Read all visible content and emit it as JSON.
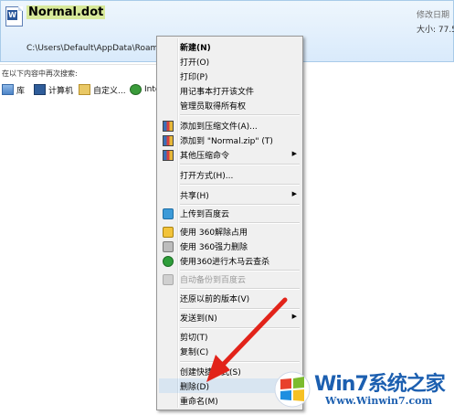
{
  "result": {
    "file_name": "Normal.dot",
    "file_path": "C:\\Users\\Default\\AppData\\Roamin",
    "modified_label": "修改日期",
    "size_label": "大小:",
    "size_value": "77.5"
  },
  "search_again": {
    "label": "在以下内容中再次搜索:",
    "locations": [
      {
        "label": "库",
        "icon": "library-icon"
      },
      {
        "label": "计算机",
        "icon": "computer-icon"
      },
      {
        "label": "自定义...",
        "icon": "folder-icon"
      },
      {
        "label": "Inte",
        "icon": "internet-icon"
      }
    ]
  },
  "context_menu": {
    "items": [
      {
        "label": "新建(N)",
        "icon": null,
        "bold": true
      },
      {
        "label": "打开(O)",
        "icon": null
      },
      {
        "label": "打印(P)",
        "icon": null
      },
      {
        "label": "用记事本打开该文件",
        "icon": null
      },
      {
        "label": "管理员取得所有权",
        "icon": null
      },
      {
        "label": "添加到压缩文件(A)...",
        "icon": "winrar-icon"
      },
      {
        "label": "添加到 \"Normal.zip\" (T)",
        "icon": "winrar-icon"
      },
      {
        "label": "其他压缩命令",
        "icon": "winrar-icon",
        "submenu": true
      },
      {
        "label": "打开方式(H)...",
        "icon": null
      },
      {
        "label": "共享(H)",
        "icon": null,
        "submenu": true
      },
      {
        "label": "上传到百度云",
        "icon": "baidu-cloud-icon"
      },
      {
        "label": "使用 360解除占用",
        "icon": "360-unlock-icon"
      },
      {
        "label": "使用 360强力删除",
        "icon": "360-shred-icon"
      },
      {
        "label": "使用360进行木马云查杀",
        "icon": "360-scan-icon"
      },
      {
        "label": "自动备份到百度云",
        "icon": "baidu-backup-icon",
        "disabled": true
      },
      {
        "label": "还原以前的版本(V)",
        "icon": null
      },
      {
        "label": "发送到(N)",
        "icon": null,
        "submenu": true
      },
      {
        "label": "剪切(T)",
        "icon": null
      },
      {
        "label": "复制(C)",
        "icon": null
      },
      {
        "label": "创建快捷方式(S)",
        "icon": null
      },
      {
        "label": "删除(D)",
        "icon": null
      },
      {
        "label": "重命名(M)",
        "icon": null
      }
    ],
    "submenu_glyph": "▶"
  },
  "watermark": {
    "brand": "Win7系统之家",
    "url": "Www.Winwin7.com"
  },
  "colors": {
    "selection_gradient_top": "#eef6fd",
    "selection_border": "#a8cbe9",
    "menu_bg": "#f0f0f0",
    "arrow": "#e2231a",
    "brand_blue": "#1c5fb0"
  }
}
